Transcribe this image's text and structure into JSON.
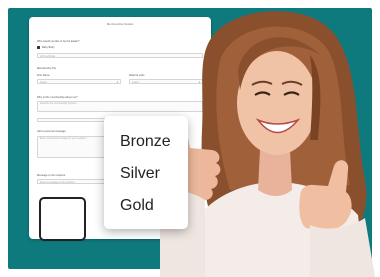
{
  "form": {
    "title": "Membership Details",
    "fields": [
      {
        "label": "Who would you like to be the leader?",
        "value": "Baby Body"
      },
      {
        "label": "",
        "value": "Gift Certificate"
      },
      {
        "label": "Membership Tier",
        "value": ""
      },
      {
        "label": "First Name",
        "value": "Select"
      },
      {
        "label": "Referral code",
        "value": "Select"
      },
      {
        "label": "Why is this membership about me?",
        "value": "Describe the membership purpose"
      },
      {
        "label": "Add a personal message",
        "value": "Enter a personal message for your recipient"
      },
      {
        "label": "Message to the recipient",
        "value": "Enter a message to the recipient"
      }
    ]
  },
  "dropdown": {
    "options": [
      "Bronze",
      "Silver",
      "Gold"
    ]
  },
  "colors": {
    "background": "#0f7a7e",
    "card": "#ffffff",
    "text": "#222222"
  }
}
